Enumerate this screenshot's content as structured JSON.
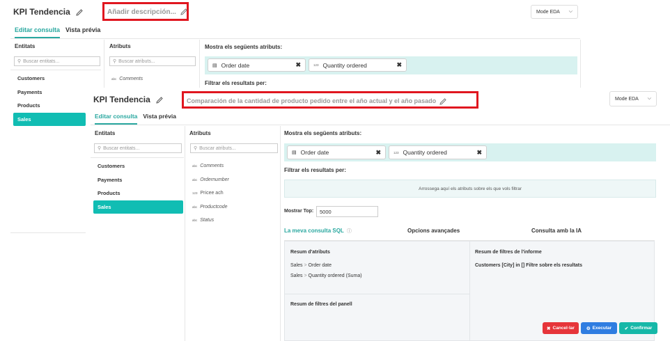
{
  "back": {
    "title": "KPI Tendencia",
    "description": "Añadir descripción...",
    "tabs": [
      "Editar consulta",
      "Vista prévia"
    ],
    "mode": "Mode EDA",
    "entities_header": "Entitats",
    "attributes_header": "Atributs",
    "entity_search_placeholder": "Buscar entitats...",
    "attribute_search_placeholder": "Buscar atributs...",
    "entities": [
      "Customers",
      "Payments",
      "Products",
      "Sales"
    ],
    "active_entity": "Sales",
    "attributes_visible": [
      {
        "type": "abc",
        "name": "Comments"
      }
    ],
    "show_label": "Mostra els següents atributs:",
    "chips": [
      {
        "icon": "calendar",
        "name": "Order date"
      },
      {
        "icon": "123",
        "name": "Quantity ordered"
      }
    ],
    "filter_label": "Filtrar els resultats per:"
  },
  "front": {
    "title": "KPI Tendencia",
    "description": "Comparación de la cantidad de producto pedido entre el año actual y el año pasado",
    "tabs": [
      "Editar consulta",
      "Vista prévia"
    ],
    "mode": "Mode EDA",
    "entities_header": "Entitats",
    "attributes_header": "Atributs",
    "entity_search_placeholder": "Buscar entitats...",
    "attribute_search_placeholder": "Buscar atributs...",
    "entities": [
      "Customers",
      "Payments",
      "Products",
      "Sales"
    ],
    "active_entity": "Sales",
    "attributes": [
      {
        "type": "abc",
        "name": "Comments"
      },
      {
        "type": "abc",
        "name": "Ordernumber"
      },
      {
        "type": "123",
        "name": "Pricee ach"
      },
      {
        "type": "abc",
        "name": "Productcode"
      },
      {
        "type": "abc",
        "name": "Status"
      }
    ],
    "show_label": "Mostra els següents atributs:",
    "chips": [
      {
        "icon": "calendar",
        "name": "Order date"
      },
      {
        "icon": "123",
        "name": "Quantity ordered"
      }
    ],
    "filter_label": "Filtrar els resultats per:",
    "dropzone": "Arrossega aquí els atributs sobre els que vols filtrar",
    "top_label": "Mostrar Top:",
    "top_value": "5000",
    "content_tabs": [
      "La meva consulta SQL",
      "Opcions avançades",
      "Consulta amb la IA"
    ],
    "summary": {
      "attr_title": "Resum d'atributs",
      "attr_rows": [
        {
          "entity": "Sales",
          "sep": ">",
          "attr": "Order date",
          "agg": ""
        },
        {
          "entity": "Sales",
          "sep": ">",
          "attr": "Quantity ordered",
          "agg": "(Suma)"
        }
      ],
      "panel_filters_title": "Resum de filtres del panell",
      "report_filters_title": "Resum de filtres de l'informe",
      "report_filter_text": "Customers [City] in []  Filtre sobre els resultats"
    },
    "buttons": {
      "cancel": "Cancel·lar",
      "execute": "Executar",
      "confirm": "Confirmar"
    }
  },
  "colors": {
    "accent": "#11bdb3",
    "highlight": "#e0161f",
    "cancel": "#e6353a",
    "execute": "#2f7de1",
    "confirm": "#16b8a8"
  }
}
